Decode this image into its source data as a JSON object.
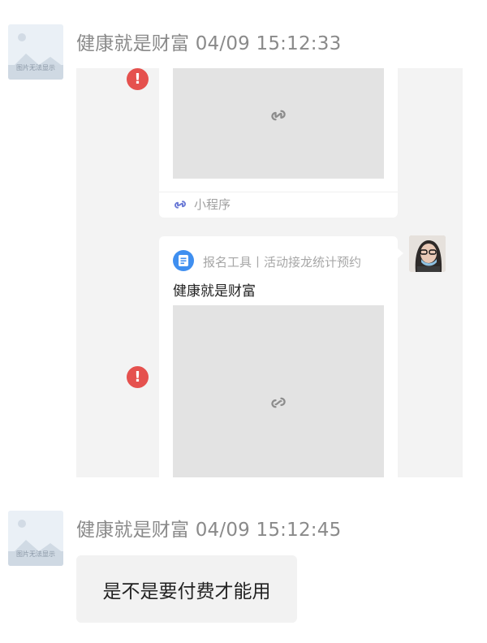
{
  "messages": [
    {
      "sender": "健康就是财富 04/09 15:12:33",
      "avatar_icon": "image-placeholder-icon",
      "avatar_caption": "图片无法显示"
    },
    {
      "sender": "健康就是财富 04/09 15:12:45",
      "avatar_icon": "image-placeholder-icon",
      "avatar_caption": "图片无法显示",
      "text": "是不是要付费才能用"
    }
  ],
  "quoted": {
    "mini_program_card": {
      "label": "小程序",
      "link_icon": "link-icon",
      "error_icon": "!"
    },
    "shared_card": {
      "source": "报名工具丨活动接龙统计预约",
      "title": "健康就是财富",
      "link_icon": "link-icon",
      "error_icon": "!"
    }
  },
  "colors": {
    "error": "#e5514e",
    "panel_bg": "#f3f3f3",
    "thumb_bg": "#e3e3e3",
    "mini_program": "#6b7ad6",
    "doc_icon": "#3f8ff0"
  }
}
